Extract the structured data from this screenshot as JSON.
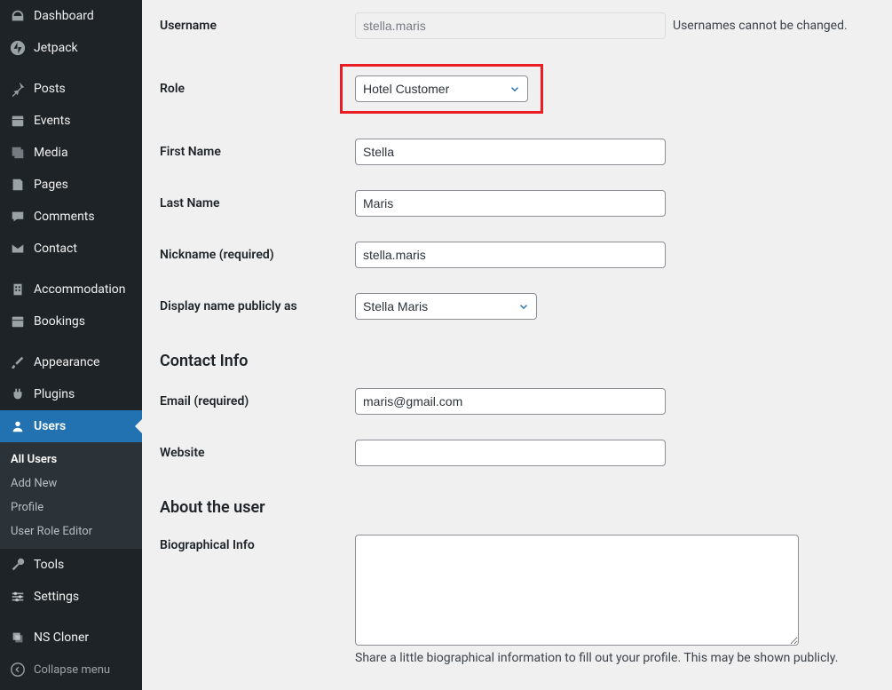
{
  "sidebar": {
    "items": [
      {
        "label": "Dashboard"
      },
      {
        "label": "Jetpack"
      },
      {
        "label": "Posts"
      },
      {
        "label": "Events"
      },
      {
        "label": "Media"
      },
      {
        "label": "Pages"
      },
      {
        "label": "Comments"
      },
      {
        "label": "Contact"
      },
      {
        "label": "Accommodation"
      },
      {
        "label": "Bookings"
      },
      {
        "label": "Appearance"
      },
      {
        "label": "Plugins"
      },
      {
        "label": "Users"
      },
      {
        "label": "Tools"
      },
      {
        "label": "Settings"
      },
      {
        "label": "NS Cloner"
      }
    ],
    "submenu": [
      {
        "label": "All Users"
      },
      {
        "label": "Add New"
      },
      {
        "label": "Profile"
      },
      {
        "label": "User Role Editor"
      }
    ],
    "collapse": "Collapse menu"
  },
  "form": {
    "username_label": "Username",
    "username_value": "stella.maris",
    "username_note": "Usernames cannot be changed.",
    "role_label": "Role",
    "role_value": "Hotel Customer",
    "first_name_label": "First Name",
    "first_name_value": "Stella",
    "last_name_label": "Last Name",
    "last_name_value": "Maris",
    "nickname_label": "Nickname (required)",
    "nickname_value": "stella.maris",
    "display_label": "Display name publicly as",
    "display_value": "Stella Maris",
    "contact_heading": "Contact Info",
    "email_label": "Email (required)",
    "email_value": "maris@gmail.com",
    "website_label": "Website",
    "website_value": "",
    "about_heading": "About the user",
    "bio_label": "Biographical Info",
    "bio_value": "",
    "bio_description": "Share a little biographical information to fill out your profile. This may be shown publicly."
  }
}
